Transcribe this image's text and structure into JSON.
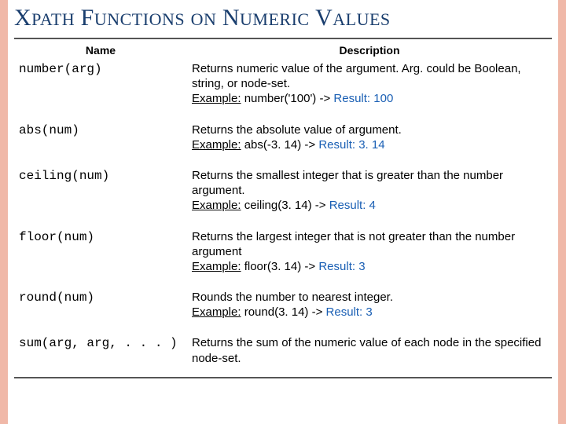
{
  "title": {
    "w1_big": "X",
    "w1_small": "PATH",
    "w2_big": "F",
    "w2_small": "UNCTIONS",
    "w3_small": "ON",
    "w4_big": "N",
    "w4_small": "UMERIC",
    "w5_big": "V",
    "w5_small": "ALUES"
  },
  "headers": {
    "name": "Name",
    "description": "Description"
  },
  "labels": {
    "example": "Example:",
    "result": "Result:"
  },
  "rows": [
    {
      "fn": "number(arg)",
      "desc": "Returns numeric value of the argument. Arg. could be Boolean, string, or node-set.",
      "ex_input": "number('100') ->",
      "ex_result": "100"
    },
    {
      "fn": "abs(num)",
      "desc": "Returns the absolute value of argument.",
      "ex_input": "abs(-3. 14) ->",
      "ex_result": "3. 14"
    },
    {
      "fn": "ceiling(num)",
      "desc": "Returns the smallest integer that is greater than the number argument.",
      "ex_input": "ceiling(3. 14) ->",
      "ex_result": "4"
    },
    {
      "fn": "floor(num)",
      "desc": "Returns the largest integer that is not greater than the number argument",
      "ex_input": "floor(3. 14) ->",
      "ex_result": "3"
    },
    {
      "fn": "round(num)",
      "desc": "Rounds the number to nearest integer.",
      "ex_input": "round(3. 14) ->",
      "ex_result": "3"
    },
    {
      "fn": "sum(arg, arg, . . . )",
      "desc": "Returns the sum of the numeric value of each node in the specified node-set.",
      "ex_input": "",
      "ex_result": ""
    }
  ]
}
